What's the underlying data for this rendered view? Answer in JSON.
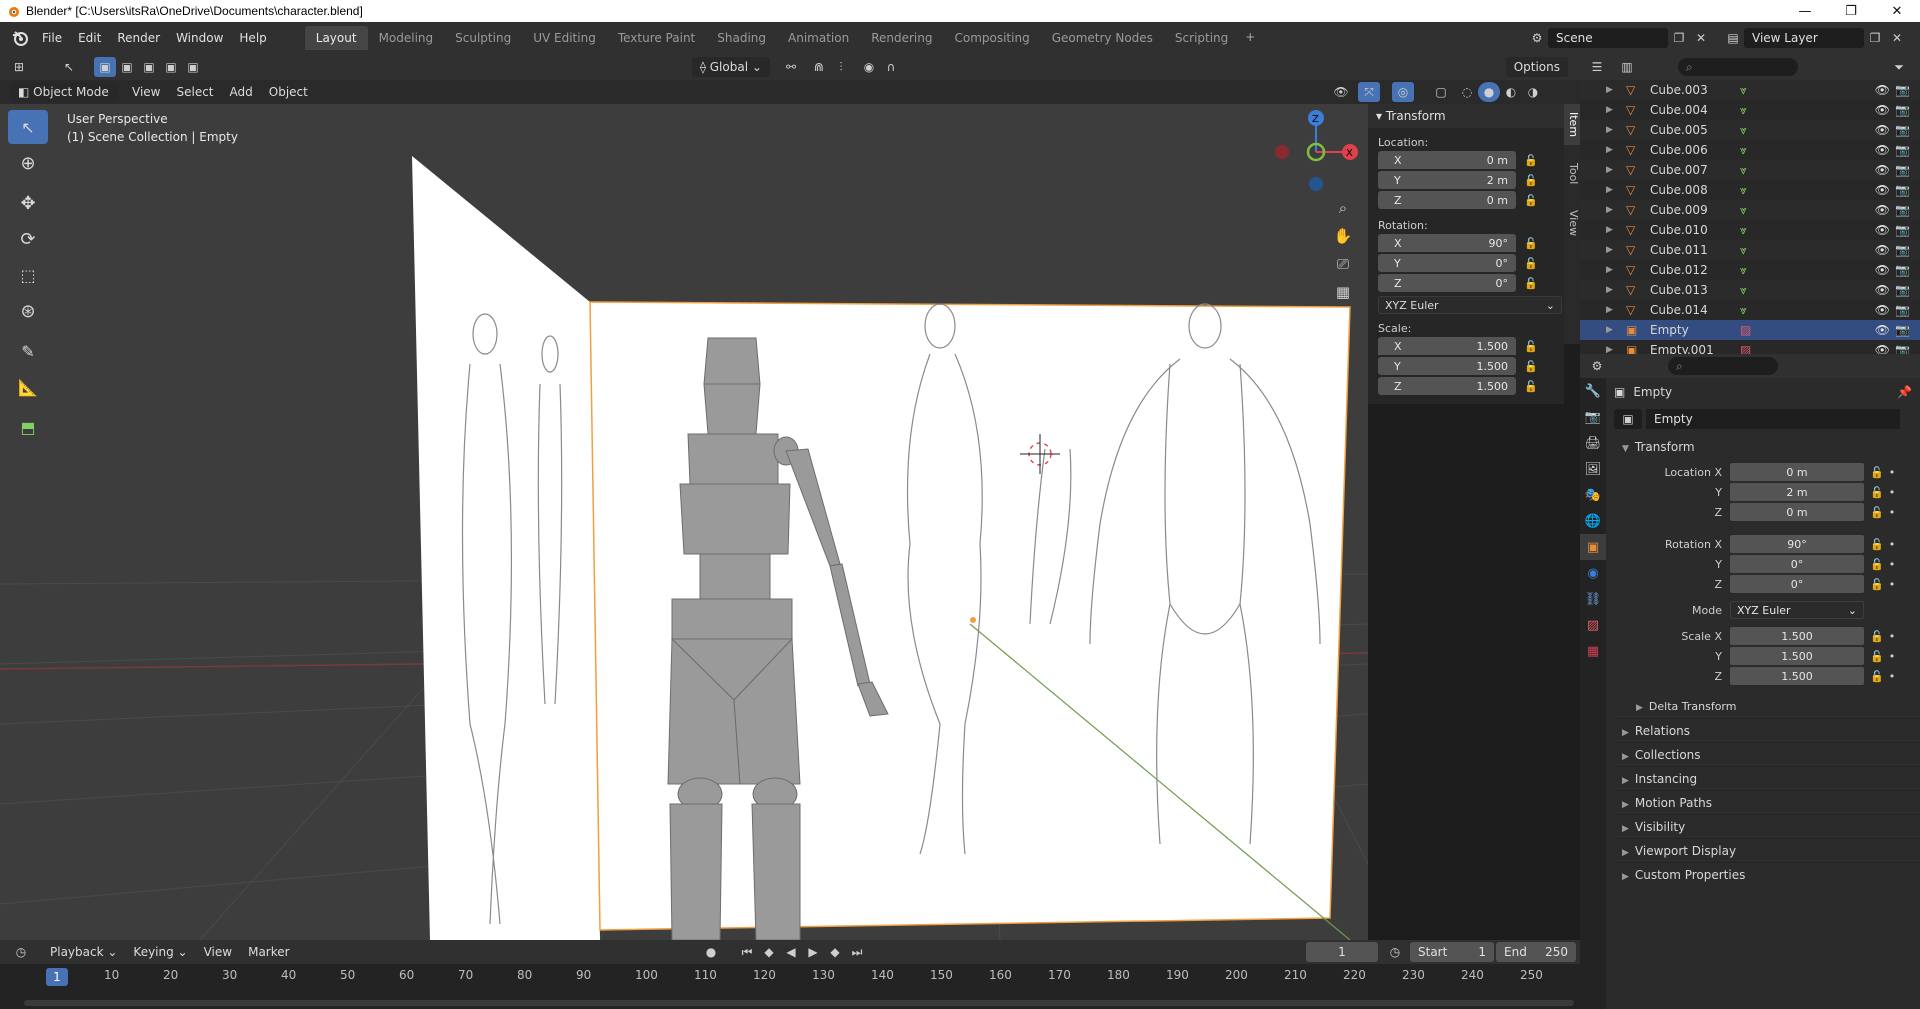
{
  "window": {
    "title": "Blender* [C:\\Users\\itsRa\\OneDrive\\Documents\\character.blend]",
    "controls": [
      "—",
      "❐",
      "✕"
    ]
  },
  "menu": [
    "File",
    "Edit",
    "Render",
    "Window",
    "Help"
  ],
  "workspaces": [
    "Layout",
    "Modeling",
    "Sculpting",
    "UV Editing",
    "Texture Paint",
    "Shading",
    "Animation",
    "Rendering",
    "Compositing",
    "Geometry Nodes",
    "Scripting"
  ],
  "active_workspace": "Layout",
  "scene": "Scene",
  "view_layer": "View Layer",
  "viewport_header": {
    "orientation": "Global",
    "options": "Options",
    "mode": "Object Mode",
    "menus": [
      "View",
      "Select",
      "Add",
      "Object"
    ]
  },
  "viewport_info": {
    "line1": "User Perspective",
    "line2": "(1) Scene Collection | Empty"
  },
  "npanel": {
    "title": "Transform",
    "location_label": "Location:",
    "location": [
      {
        "axis": "X",
        "value": "0 m"
      },
      {
        "axis": "Y",
        "value": "2 m"
      },
      {
        "axis": "Z",
        "value": "0 m"
      }
    ],
    "rotation_label": "Rotation:",
    "rotation": [
      {
        "axis": "X",
        "value": "90°"
      },
      {
        "axis": "Y",
        "value": "0°"
      },
      {
        "axis": "Z",
        "value": "0°"
      }
    ],
    "rotation_mode": "XYZ Euler",
    "scale_label": "Scale:",
    "scale": [
      {
        "axis": "X",
        "value": "1.500"
      },
      {
        "axis": "Y",
        "value": "1.500"
      },
      {
        "axis": "Z",
        "value": "1.500"
      }
    ],
    "tabs": [
      "Item",
      "Tool",
      "View"
    ]
  },
  "outliner": {
    "items": [
      {
        "name": "Cube.003",
        "type": "mesh"
      },
      {
        "name": "Cube.004",
        "type": "mesh"
      },
      {
        "name": "Cube.005",
        "type": "mesh"
      },
      {
        "name": "Cube.006",
        "type": "mesh"
      },
      {
        "name": "Cube.007",
        "type": "mesh"
      },
      {
        "name": "Cube.008",
        "type": "mesh"
      },
      {
        "name": "Cube.009",
        "type": "mesh"
      },
      {
        "name": "Cube.010",
        "type": "mesh"
      },
      {
        "name": "Cube.011",
        "type": "mesh"
      },
      {
        "name": "Cube.012",
        "type": "mesh"
      },
      {
        "name": "Cube.013",
        "type": "mesh"
      },
      {
        "name": "Cube.014",
        "type": "mesh"
      },
      {
        "name": "Empty",
        "type": "empty",
        "selected": true
      },
      {
        "name": "Empty.001",
        "type": "empty"
      }
    ]
  },
  "properties": {
    "object_name": "Empty",
    "data_name": "Empty",
    "transform_title": "Transform",
    "location_label": "Location X",
    "location": [
      "0 m",
      "2 m",
      "0 m"
    ],
    "rotation_label": "Rotation X",
    "rotation": [
      "90°",
      "0°",
      "0°"
    ],
    "mode_label": "Mode",
    "mode_value": "XYZ Euler",
    "scale_label": "Scale X",
    "scale": [
      "1.500",
      "1.500",
      "1.500"
    ],
    "axis_y": "Y",
    "axis_z": "Z",
    "delta_transform": "Delta Transform",
    "sections": [
      "Relations",
      "Collections",
      "Instancing",
      "Motion Paths",
      "Visibility",
      "Viewport Display",
      "Custom Properties"
    ]
  },
  "timeline": {
    "menus": [
      "Playback",
      "Keying",
      "View",
      "Marker"
    ],
    "current_frame": "1",
    "start_label": "Start",
    "start": "1",
    "end_label": "End",
    "end": "250",
    "ticks": [
      "10",
      "20",
      "30",
      "40",
      "50",
      "60",
      "70",
      "80",
      "90",
      "100",
      "110",
      "120",
      "130",
      "140",
      "150",
      "160",
      "170",
      "180",
      "190",
      "200",
      "210",
      "220",
      "230",
      "240",
      "250"
    ]
  },
  "gizmo": {
    "x": "X",
    "y": "Y",
    "z": "Z"
  },
  "colors": {
    "accent": "#4772b3",
    "selection": "#334d80",
    "x_axis": "#e0404a",
    "y_axis": "#80c040",
    "z_axis": "#3c7fd8",
    "object_orange": "#e88c3a"
  }
}
